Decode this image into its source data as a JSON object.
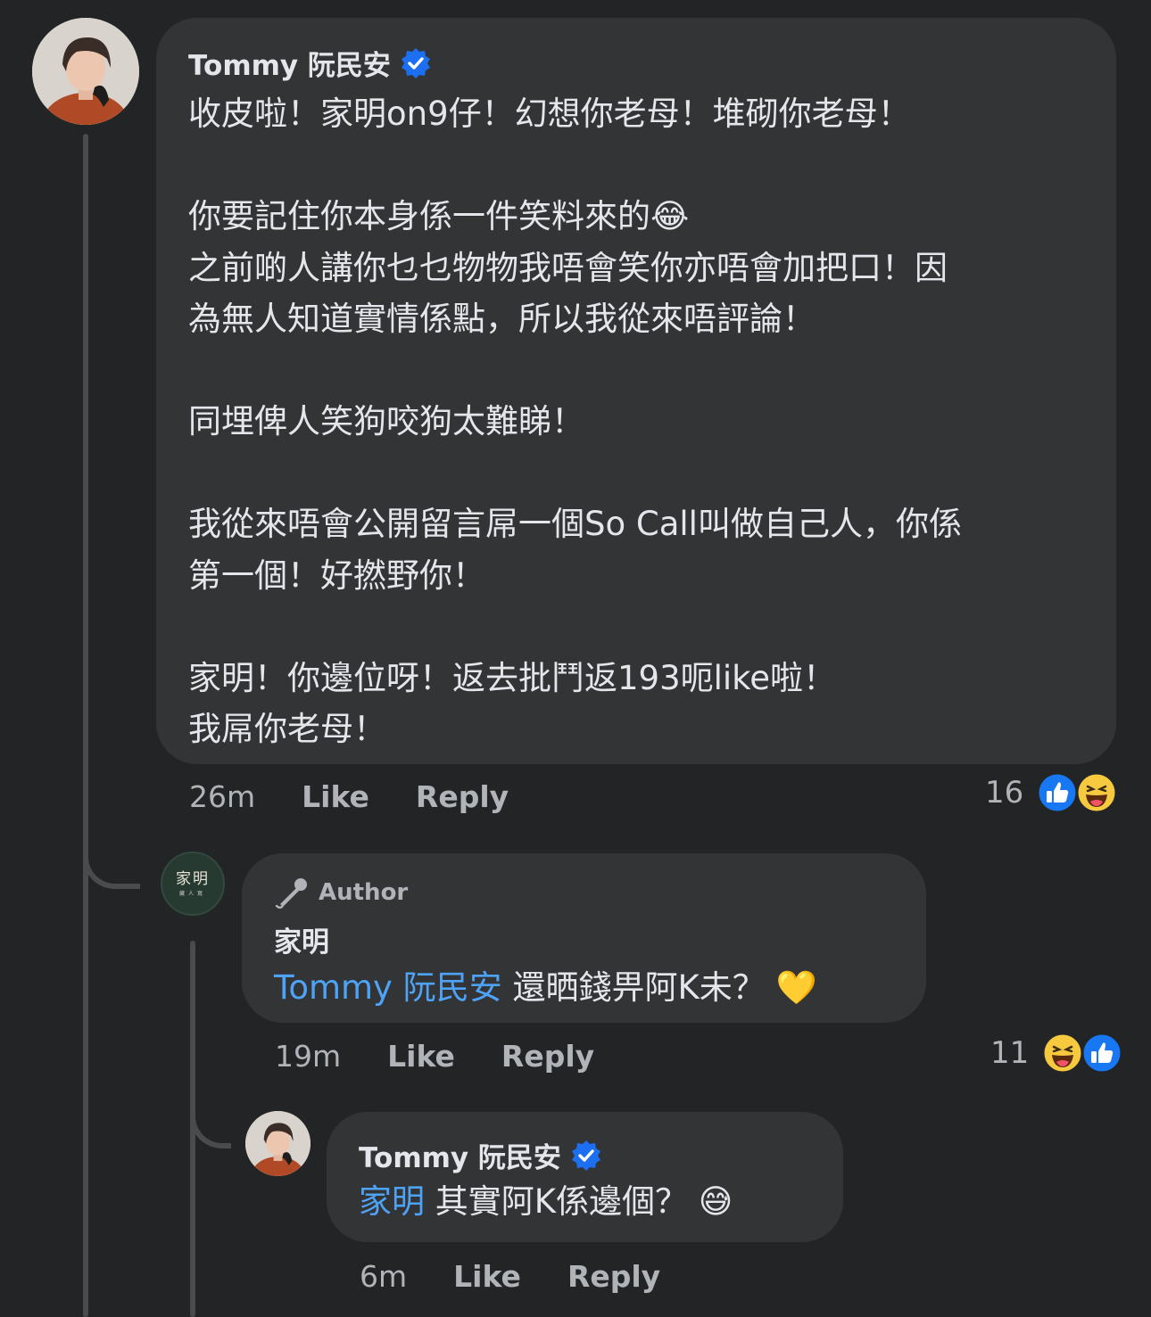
{
  "thread": {
    "comment1": {
      "author": "Tommy 阮民安",
      "verified": true,
      "text": "收皮啦！家明on9仔！幻想你老母！堆砌你老母！\n\n你要記住你本身係一件笑料來的😂\n之前啲人講你乜乜物物我唔會笑你亦唔會加把口！因\n為無人知道實情係點，所以我從來唔評論！\n\n同埋俾人笑狗咬狗太難睇！\n\n我從來唔會公開留言屌一個So Call叫做自己人，你係\n第一個！好撚野你！\n\n家明！你邊位呀！返去批鬥返193呃like啦！\n我屌你老母！",
      "time": "26m",
      "like_label": "Like",
      "reply_label": "Reply",
      "reaction_count": "16",
      "reactions": [
        "like-icon",
        "haha-icon"
      ]
    },
    "comment2": {
      "badge": "Author",
      "author": "家明",
      "avatar_text": "家明",
      "avatar_subtext": "藏人寫",
      "mention": "Tommy 阮民安",
      "text": " 還晒錢畀阿K未？ 💛",
      "time": "19m",
      "like_label": "Like",
      "reply_label": "Reply",
      "reaction_count": "11",
      "reactions": [
        "haha-icon",
        "like-icon"
      ]
    },
    "comment3": {
      "author": "Tommy 阮民安",
      "verified": true,
      "mention": "家明",
      "text": " 其實阿K係邊個？ 😅",
      "time": "6m",
      "like_label": "Like",
      "reply_label": "Reply"
    }
  },
  "colors": {
    "background": "#232426",
    "bubble": "#333436",
    "mention": "#4fa3f7",
    "verified": "#1d6ff2",
    "like_blue": "#1877f2",
    "haha_yellow": "#f7c93f"
  }
}
